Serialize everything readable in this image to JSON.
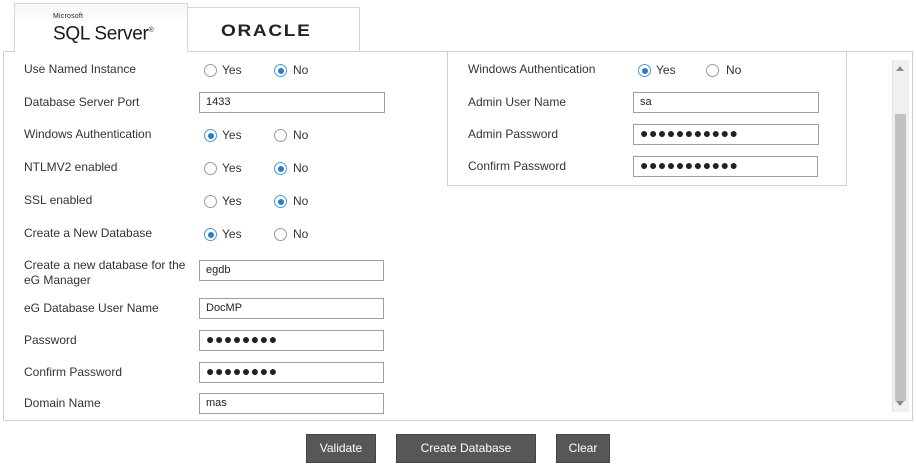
{
  "tabs": {
    "sql": {
      "brand_small": "Microsoft",
      "brand_name": "SQL Server",
      "trademark": "®"
    },
    "oracle": {
      "brand_name": "ORACLE"
    }
  },
  "radio_labels": {
    "yes": "Yes",
    "no": "No"
  },
  "left_form": {
    "use_named_instance": {
      "label": "Use Named Instance",
      "selected": "No"
    },
    "db_server_port": {
      "label": "Database Server Port",
      "value": "1433"
    },
    "windows_auth": {
      "label": "Windows Authentication",
      "selected": "Yes"
    },
    "ntlmv2": {
      "label": "NTLMV2 enabled",
      "selected": "No"
    },
    "ssl": {
      "label": "SSL enabled",
      "selected": "No"
    },
    "create_new_db": {
      "label": "Create a New Database",
      "selected": "Yes"
    },
    "new_db_name": {
      "label": "Create a new database for the eG Manager",
      "value": "egdb"
    },
    "eg_db_user": {
      "label": "eG Database User Name",
      "value": "DocMP"
    },
    "password": {
      "label": "Password",
      "value": "●●●●●●●●"
    },
    "confirm_password": {
      "label": "Confirm Password",
      "value": "●●●●●●●●"
    },
    "domain_name": {
      "label": "Domain Name",
      "value": "mas"
    }
  },
  "right_form": {
    "windows_auth": {
      "label": "Windows Authentication",
      "selected": "Yes"
    },
    "admin_user": {
      "label": "Admin User Name",
      "value": "sa"
    },
    "admin_password": {
      "label": "Admin Password",
      "value": "●●●●●●●●●●●"
    },
    "confirm_password": {
      "label": "Confirm Password",
      "value": "●●●●●●●●●●●"
    }
  },
  "buttons": {
    "validate": "Validate",
    "create_database": "Create Database",
    "clear": "Clear"
  },
  "colors": {
    "button_bg": "#575757",
    "radio_selected": "#2a7cc4"
  }
}
